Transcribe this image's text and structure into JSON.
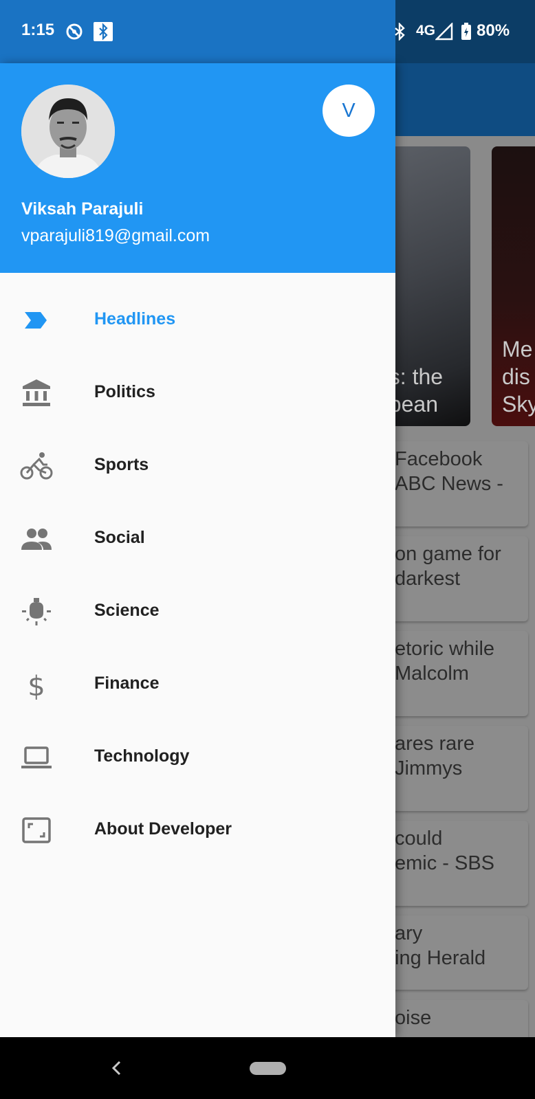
{
  "status_bar": {
    "time": "1:15",
    "network": "4G",
    "battery": "80%"
  },
  "drawer": {
    "account": {
      "name": "Viksah Parajuli",
      "email": "vparajuli819@gmail.com",
      "badge_initial": "V"
    },
    "items": [
      {
        "label": "Headlines",
        "icon": "headlines-chevron-icon",
        "active": true
      },
      {
        "label": "Politics",
        "icon": "bank-icon",
        "active": false
      },
      {
        "label": "Sports",
        "icon": "bicycle-icon",
        "active": false
      },
      {
        "label": "Social",
        "icon": "people-icon",
        "active": false
      },
      {
        "label": "Science",
        "icon": "lightbulb-icon",
        "active": false
      },
      {
        "label": "Finance",
        "icon": "dollar-icon",
        "active": false
      },
      {
        "label": "Technology",
        "icon": "laptop-icon",
        "active": false
      },
      {
        "label": "About Developer",
        "icon": "fullscreen-icon",
        "active": false
      }
    ]
  },
  "background": {
    "headline_cards": [
      {
        "lines": [
          "us:  the",
          "opean"
        ]
      },
      {
        "lines": [
          "Me",
          "dis",
          "Sky"
        ]
      }
    ],
    "news_items": [
      {
        "lines": [
          "Facebook",
          "ABC News -"
        ]
      },
      {
        "lines": [
          "on game for",
          " darkest"
        ]
      },
      {
        "lines": [
          "etoric while",
          "Malcolm"
        ]
      },
      {
        "lines": [
          "ares rare",
          "Jimmys"
        ]
      },
      {
        "lines": [
          " could",
          "emic - SBS"
        ]
      },
      {
        "lines": [
          "ary",
          "ing Herald"
        ]
      },
      {
        "lines": [
          "oise",
          ""
        ]
      }
    ]
  },
  "colors": {
    "primary": "#2196f3",
    "primary_dark": "#1a73c3",
    "drawer_bg": "#fafafa",
    "text_dark": "#212121",
    "icon_gray": "#757575"
  }
}
